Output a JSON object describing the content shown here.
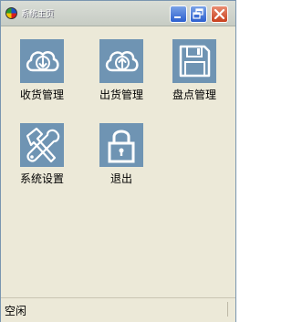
{
  "window": {
    "title": "系统主页",
    "buttons": {
      "minimize": "minimize",
      "restore": "restore",
      "close": "close"
    }
  },
  "menu_items": [
    {
      "label": "收货管理",
      "icon": "cloud-download-icon"
    },
    {
      "label": "出货管理",
      "icon": "cloud-upload-icon"
    },
    {
      "label": "盘点管理",
      "icon": "save-floppy-icon"
    },
    {
      "label": "系统设置",
      "icon": "tools-icon"
    },
    {
      "label": "退出",
      "icon": "lock-icon"
    }
  ],
  "status": {
    "text": "空闲"
  },
  "colors": {
    "tile": "#6f94b3",
    "window_bg": "#ece9d8",
    "close_button": "#c8401e",
    "caption_button": "#2c5fcf"
  }
}
